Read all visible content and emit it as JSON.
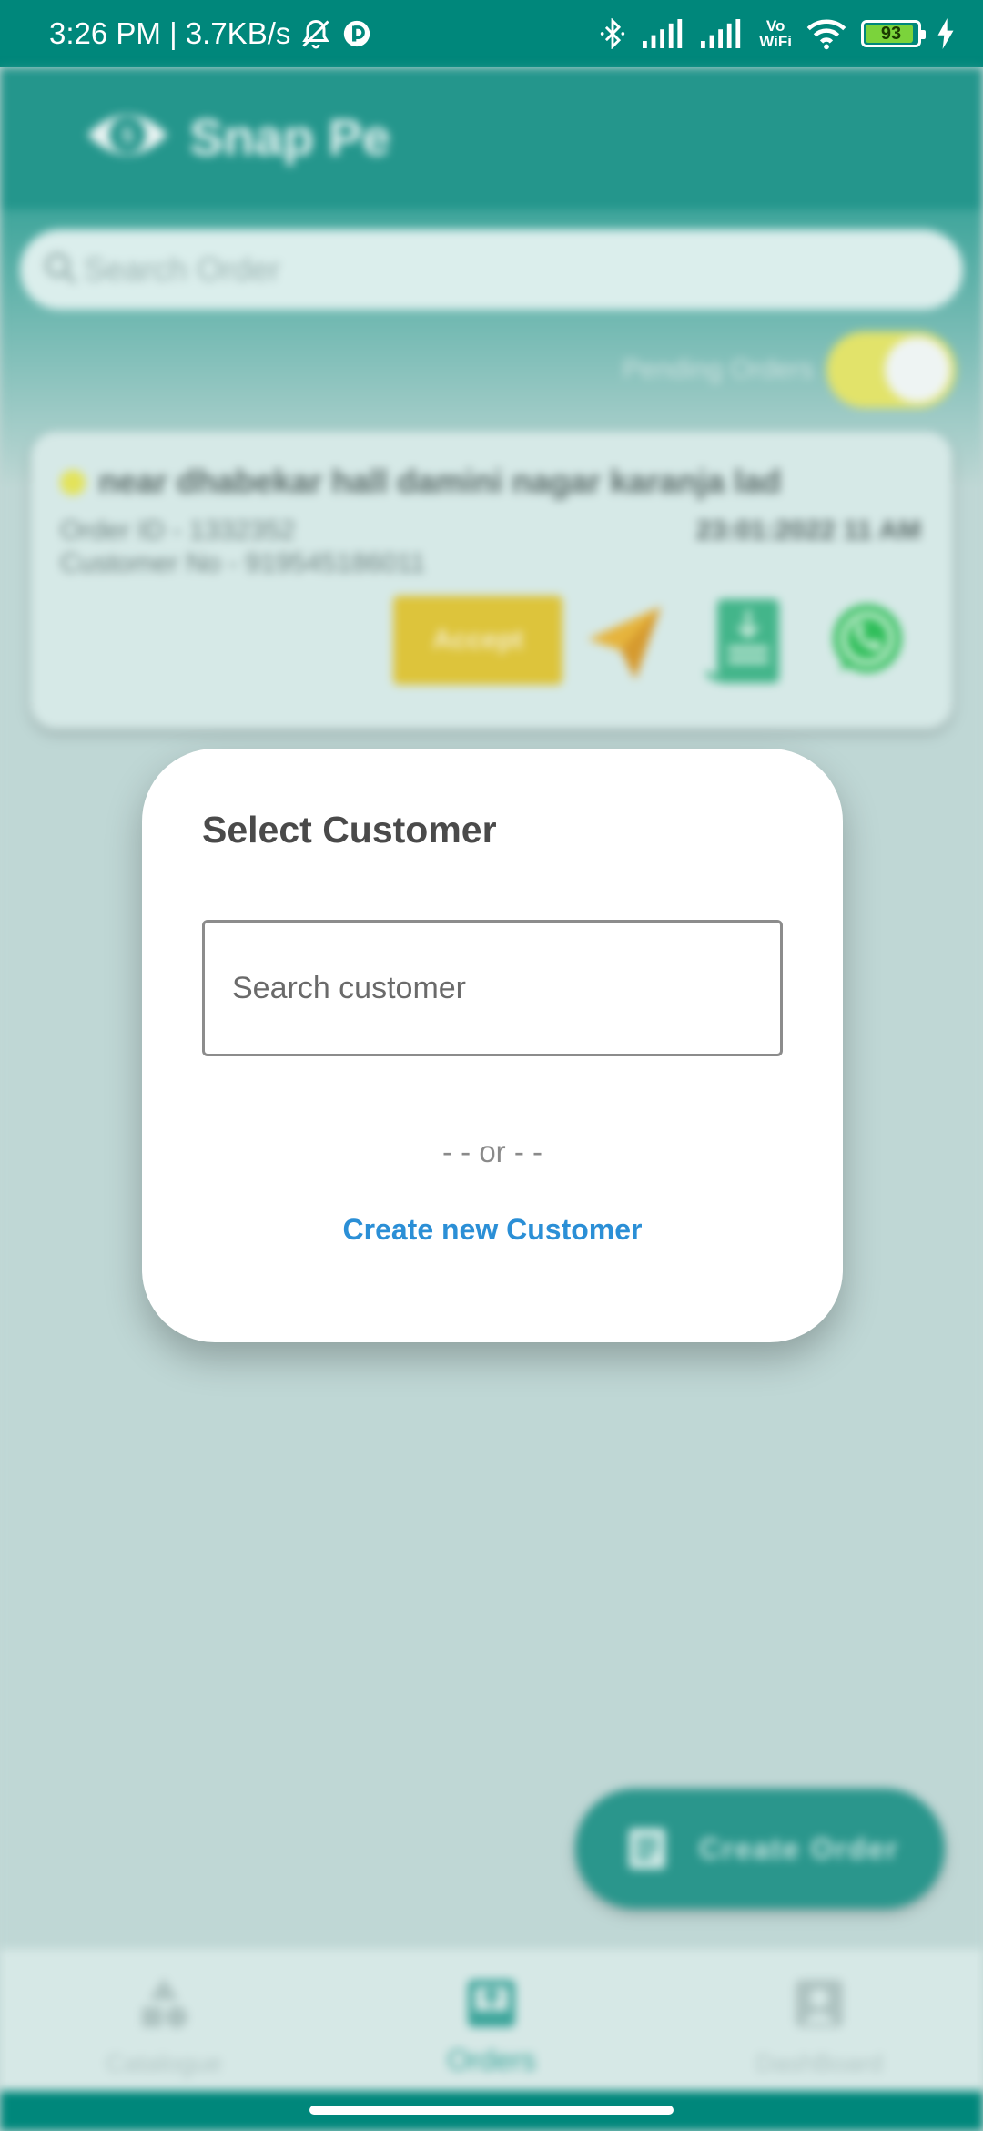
{
  "status_bar": {
    "time_speed": "3:26 PM | 3.7KB/s",
    "vowifi_top": "Vo",
    "vowifi_bottom": "WiFi",
    "battery": "93"
  },
  "app": {
    "brand": "Snap Pe",
    "search_placeholder": "Search Order",
    "pending_label": "Pending Orders",
    "pending_toggle_on": true,
    "order": {
      "title": "near dhabekar hall damini nagar karanja lad",
      "order_id": "Order ID - 1332352",
      "customer_no": "Customer No - 919545186011",
      "datetime": "23:01:2022 11 AM",
      "accept_label": "Accept"
    },
    "fab_label": "Create Order",
    "nav": {
      "catalogue": "Catalogue",
      "orders": "Orders",
      "dashboard": "DashBoard"
    }
  },
  "dialog": {
    "title": "Select Customer",
    "search_placeholder": "Search customer",
    "or_text": "- - or - -",
    "create_link": "Create new Customer"
  },
  "colors": {
    "status_bar": "#00877b",
    "accent_teal": "#24968c",
    "accept_yellow": "#ddc43b",
    "link_blue": "#2b8fd6"
  }
}
